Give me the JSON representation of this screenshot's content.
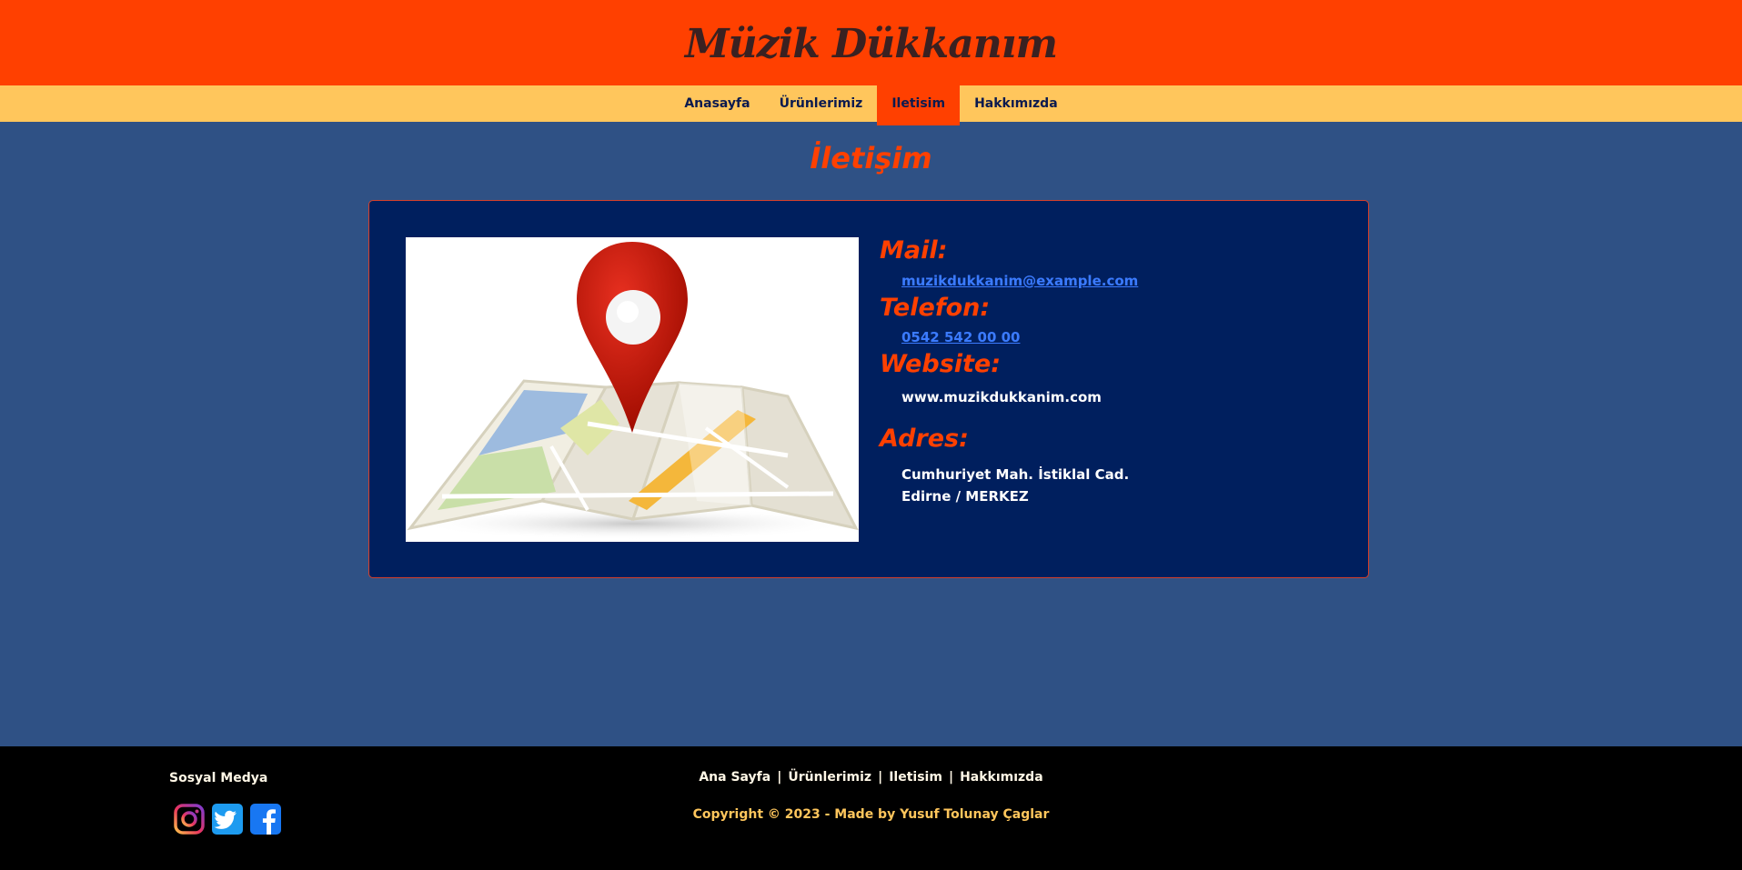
{
  "header": {
    "site_title": "Müzik Dükkanım"
  },
  "nav": {
    "items": [
      {
        "label": "Anasayfa"
      },
      {
        "label": "Ürünlerimiz"
      },
      {
        "label": "Iletisim"
      },
      {
        "label": "Hakkımızda"
      }
    ],
    "active": "Iletisim"
  },
  "main": {
    "title": "İletişim",
    "contact": {
      "mail_label": "Mail:",
      "mail_value": "muzikdukkanim@example.com",
      "phone_label": "Telefon:",
      "phone_value": "0542 542 00 00",
      "website_label": "Website:",
      "website_value": "www.muzikdukkanim.com",
      "address_label": "Adres:",
      "address_line1": "Cumhuriyet Mah. İstiklal Cad.",
      "address_line2": "Edirne / MERKEZ"
    },
    "map_icon": "map-location-pin-icon"
  },
  "footer": {
    "social_title": "Sosyal Medya",
    "social_icons": [
      "instagram-icon",
      "twitter-icon",
      "facebook-icon"
    ],
    "links": [
      "Ana Sayfa",
      "Ürünlerimiz",
      "Iletisim",
      "Hakkımızda"
    ],
    "separator": "|",
    "copyright": "Copyright © 2023 - Made by Yusuf Tolunay Çaglar"
  },
  "colors": {
    "header_bg": "#ff4000",
    "nav_bg": "#ffc65c",
    "page_bg": "#2f5185",
    "card_bg": "#001f5e",
    "accent": "#ff4000",
    "link": "#3b7bff",
    "footer_bg": "#000000"
  }
}
